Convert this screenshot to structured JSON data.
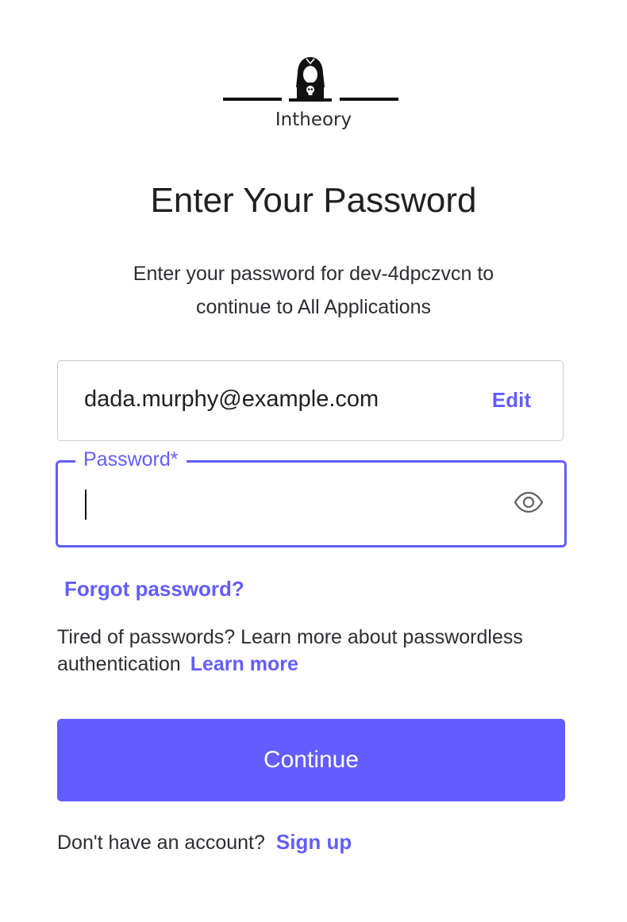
{
  "brand": {
    "name": "Intheory",
    "logo_icon": "hooded-hacker-laptop-icon"
  },
  "header": {
    "title": "Enter Your Password",
    "subtitle_line1": "Enter your password for dev-4dpczvcn to",
    "subtitle_line2": "continue to All Applications"
  },
  "email": {
    "value": "dada.murphy@example.com",
    "edit_label": "Edit"
  },
  "password": {
    "label": "Password*",
    "value": "",
    "toggle_icon": "eye-icon"
  },
  "links": {
    "forgot_password": "Forgot password?",
    "passwordless_text": "Tired of passwords? Learn more about passwordless authentication",
    "learn_more": "Learn more"
  },
  "actions": {
    "continue_label": "Continue"
  },
  "signup": {
    "prompt": "Don't have an account?",
    "link": "Sign up"
  },
  "colors": {
    "accent": "#635dff",
    "text": "#1f1f24",
    "border": "#c9cace"
  }
}
